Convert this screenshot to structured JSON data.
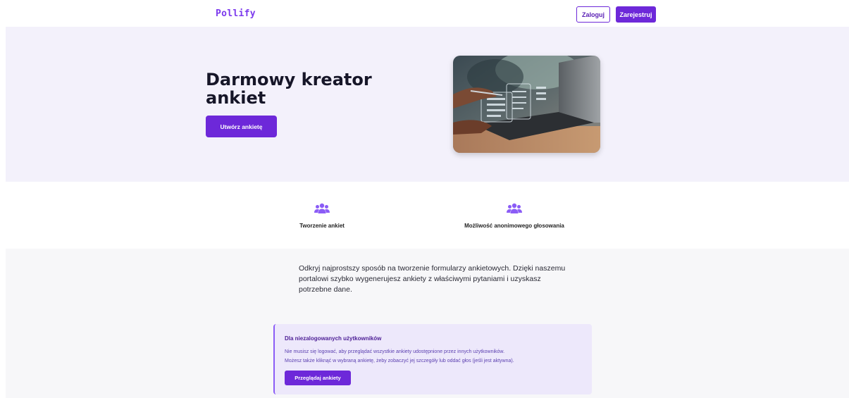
{
  "header": {
    "logo": "Pollify",
    "login_label": "Zaloguj",
    "register_label": "Zarejestruj"
  },
  "hero": {
    "title": "Darmowy kreator ankiet",
    "cta_label": "Utwórz ankietę"
  },
  "features": [
    {
      "icon": "users-icon",
      "label": "Tworzenie ankiet"
    },
    {
      "icon": "users-icon",
      "label": "Możliwość anonimowego głosowania"
    }
  ],
  "info": {
    "description": "Odkryj najprostszy sposób na tworzenie formularzy ankietowych. Dzięki naszemu portalowi szybko wygenerujesz ankiety z właściwymi pytaniami i uzyskasz potrzebne dane.",
    "card": {
      "title": "Dla niezalogowanych użytkowników",
      "line1": "Nie musisz się logować, aby przeglądać wszystkie ankiety udostępnione przez innych użytkowników.",
      "line2": "Możesz także kliknąć w wybraną ankietę, żeby zobaczyć jej szczegóły lub oddać głos (jeśli jest aktywna).",
      "button_label": "Przeglądaj ankiety"
    }
  },
  "colors": {
    "accent": "#6d28d9",
    "hero_bg": "#f3f1fb",
    "card_bg": "#ede8fb",
    "icon": "#8b5cf6"
  }
}
